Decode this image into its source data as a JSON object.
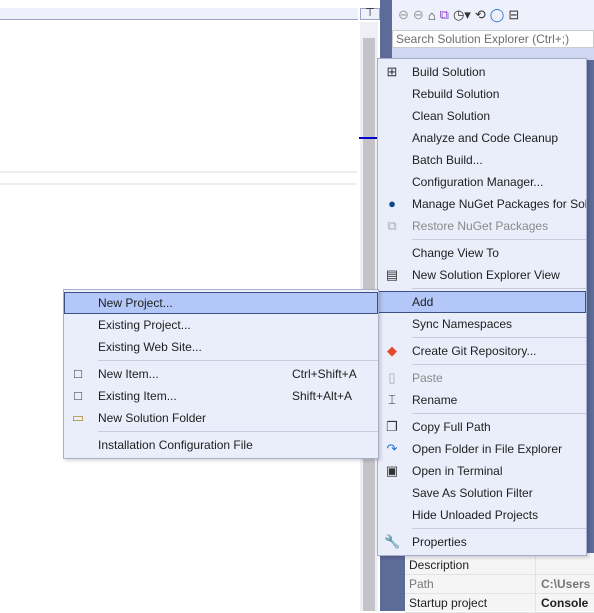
{
  "solution_explorer": {
    "search_placeholder": "Search Solution Explorer (Ctrl+;)",
    "properties": [
      {
        "key": "Description",
        "value": ""
      },
      {
        "key": "Path",
        "value": "C:\\Users"
      },
      {
        "key": "Startup project",
        "value": "Console"
      }
    ]
  },
  "context_menu": {
    "items": [
      {
        "label": "Build Solution",
        "icon": "build-icon"
      },
      {
        "label": "Rebuild Solution"
      },
      {
        "label": "Clean Solution"
      },
      {
        "label": "Analyze and Code Cleanup"
      },
      {
        "label": "Batch Build..."
      },
      {
        "label": "Configuration Manager..."
      },
      {
        "label": "Manage NuGet Packages for Solution...",
        "icon": "nuget-icon"
      },
      {
        "label": "Restore NuGet Packages",
        "icon": "restore-icon",
        "disabled": true
      },
      {
        "sep": true
      },
      {
        "label": "Change View To"
      },
      {
        "label": "New Solution Explorer View",
        "icon": "window-icon"
      },
      {
        "sep": true
      },
      {
        "label": "Add",
        "selected": true
      },
      {
        "label": "Sync Namespaces"
      },
      {
        "sep": true
      },
      {
        "label": "Create Git Repository...",
        "icon": "git-icon"
      },
      {
        "sep": true
      },
      {
        "label": "Paste",
        "icon": "paste-icon",
        "disabled": true
      },
      {
        "label": "Rename",
        "icon": "rename-icon"
      },
      {
        "sep": true
      },
      {
        "label": "Copy Full Path",
        "icon": "copy-icon"
      },
      {
        "label": "Open Folder in File Explorer",
        "icon": "open-folder-icon"
      },
      {
        "label": "Open in Terminal",
        "icon": "terminal-icon"
      },
      {
        "label": "Save As Solution Filter"
      },
      {
        "label": "Hide Unloaded Projects"
      },
      {
        "sep": true
      },
      {
        "label": "Properties",
        "icon": "wrench-icon"
      }
    ]
  },
  "add_submenu": {
    "items": [
      {
        "label": "New Project...",
        "selected": true
      },
      {
        "label": "Existing Project..."
      },
      {
        "label": "Existing Web Site..."
      },
      {
        "sep": true
      },
      {
        "label": "New Item...",
        "shortcut": "Ctrl+Shift+A",
        "icon": "new-item-icon"
      },
      {
        "label": "Existing Item...",
        "shortcut": "Shift+Alt+A",
        "icon": "existing-item-icon"
      },
      {
        "label": "New Solution Folder",
        "icon": "new-folder-icon"
      },
      {
        "sep": true
      },
      {
        "label": "Installation Configuration File"
      }
    ]
  },
  "colors": {
    "menu_bg": "#e9eefa",
    "highlight": "#b3c8f8",
    "highlight_border": "#3c5086",
    "frame": "#5d6b99"
  }
}
